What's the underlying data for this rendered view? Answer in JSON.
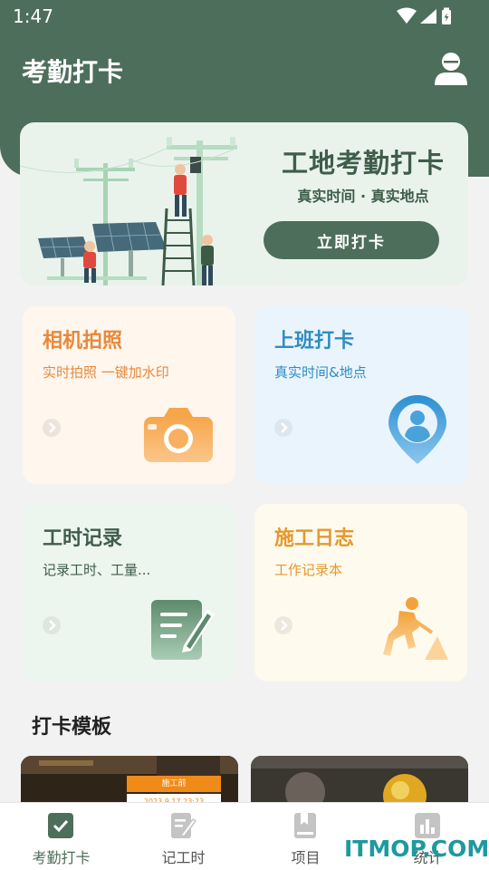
{
  "status_bar": {
    "time": "1:47"
  },
  "header": {
    "title": "考勤打卡"
  },
  "banner": {
    "title": "工地考勤打卡",
    "subtitle": "真实时间 · 真实地点",
    "button_label": "立即打卡"
  },
  "cards": [
    {
      "title": "相机拍照",
      "subtitle": "实时拍照 一键加水印",
      "icon": "camera-icon",
      "accent": "#e8893a",
      "bg": "#fff6ee"
    },
    {
      "title": "上班打卡",
      "subtitle": "真实时间&地点",
      "icon": "location-pin-icon",
      "accent": "#2f8cc4",
      "bg": "#eaf4fd"
    },
    {
      "title": "工时记录",
      "subtitle": "记录工时、工量...",
      "icon": "notepad-pencil-icon",
      "accent": "#3f5d49",
      "bg": "#edf5ef"
    },
    {
      "title": "施工日志",
      "subtitle": "工作记录本",
      "icon": "worker-shovel-icon",
      "accent": "#e3992e",
      "bg": "#fffaee"
    }
  ],
  "templates_section": {
    "title": "打卡模板"
  },
  "template_thumbs": [
    {
      "label": "施工前",
      "line2": "2023.9.17 23:23"
    },
    {
      "label": ""
    }
  ],
  "tabbar": [
    {
      "label": "考勤打卡",
      "icon": "checkbox-icon",
      "active": true
    },
    {
      "label": "记工时",
      "icon": "edit-note-icon",
      "active": false
    },
    {
      "label": "项目",
      "icon": "book-icon",
      "active": false
    },
    {
      "label": "统计",
      "icon": "bar-chart-icon",
      "active": false
    }
  ],
  "watermark": "ITMOP.COM",
  "colors": {
    "primary": "#4d6e5a",
    "background": "#f2f2f2"
  }
}
